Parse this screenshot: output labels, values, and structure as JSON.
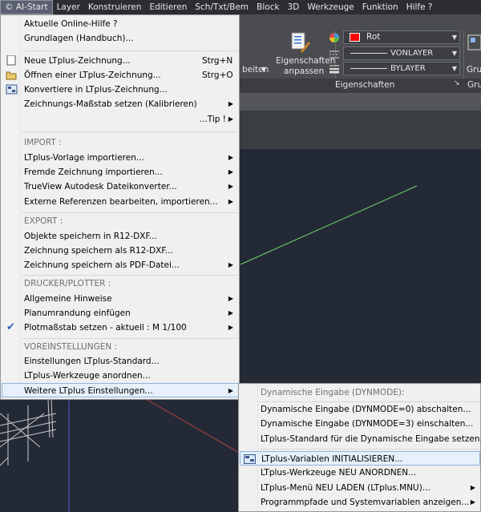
{
  "menubar": {
    "items": [
      "© AI-Start",
      "Layer",
      "Konstruieren",
      "Editieren",
      "Sch/Txt/Bem",
      "Block",
      "3D",
      "Werkzeuge",
      "Funktion",
      "Hilfe ?"
    ]
  },
  "ribbon": {
    "eigenschaften_anpassen_line1": "Eigenschaften",
    "eigenschaften_anpassen_line2": "anpassen",
    "beiten_label": "beiten",
    "color_value": "Rot",
    "linetype_value": "VONLAYER",
    "lineweight_value": "BYLAYER",
    "panel_title": "Eigenschaften",
    "gruppe_label": "Grup",
    "gruppe_footer": "Grup",
    "color_swatch": "#ff0000"
  },
  "menu": {
    "items": [
      {
        "label": "Aktuelle Online-Hilfe ?",
        "u": "A"
      },
      {
        "label": "Grundlagen (Handbuch)...",
        "u": "G"
      },
      {
        "label": "Neue LTplus-Zeichnung...",
        "u": "N",
        "shortcut": "Strg+N"
      },
      {
        "label": "Öffnen einer LTplus-Zeichnung...",
        "u": "Ö",
        "shortcut": "Strg+O"
      },
      {
        "label": "Konvertiere in LTplus-Zeichnung...",
        "u": "K"
      },
      {
        "label": "Zeichnungs-Maßstab setzen  (Kalibrieren)",
        "u": "Z"
      },
      {
        "label": "...Tip !"
      },
      {
        "label": "IMPORT :"
      },
      {
        "label": "LTplus-Vorlage importieren..."
      },
      {
        "label": "Fremde Zeichnung importieren..."
      },
      {
        "label": "TrueView Autodesk Dateikonverter..."
      },
      {
        "label": "Externe Referenzen bearbeiten, importieren..."
      },
      {
        "label": "EXPORT :"
      },
      {
        "label": "Objekte speichern in R12-DXF..."
      },
      {
        "label": "Zeichnung speichern als R12-DXF..."
      },
      {
        "label": "Zeichnung speichern als PDF-Datei..."
      },
      {
        "label": "DRUCKER/PLOTTER :"
      },
      {
        "label": "Allgemeine Hinweise"
      },
      {
        "label": "Planumrandung einfügen"
      },
      {
        "label": "Plotmaßstab setzen - aktuell : M 1/100"
      },
      {
        "label": "VOREINSTELLUNGEN :"
      },
      {
        "label": "Einstellungen LTplus-Standard..."
      },
      {
        "label": "LTplus-Werkzeuge anordnen...",
        "u": "L"
      },
      {
        "label": "Weitere LTplus Einstellungen...",
        "u": "W"
      }
    ]
  },
  "submenu": {
    "items": [
      {
        "label": "Dynamische Eingabe (DYNMODE):"
      },
      {
        "label": "Dynamische Eingabe (DYNMODE=0) abschalten...",
        "u": "a",
        "pre": "Dynamische Eingabe (DYNMODE=0) ",
        "rest": "bschalten..."
      },
      {
        "label": "Dynamische Eingabe (DYNMODE=3) einschalten...",
        "u": "e",
        "pre": "Dynamische Eingabe (DYNMODE=3) ",
        "rest": "inschalten..."
      },
      {
        "label": "LTplus-Standard für die Dynamische Eingabe setzen...",
        "u": "L"
      },
      {
        "label": "LTplus-Variablen INITIALISIEREN...",
        "u": "L"
      },
      {
        "label": "LTplus-Werkzeuge NEU ANORDNEN...",
        "u": "L"
      },
      {
        "label": "LTplus-Menü NEU LADEN (LTplus.MNU)...",
        "u": "L"
      },
      {
        "label": "Programmpfade und Systemvariablen anzeigen...",
        "u": "P"
      }
    ]
  }
}
